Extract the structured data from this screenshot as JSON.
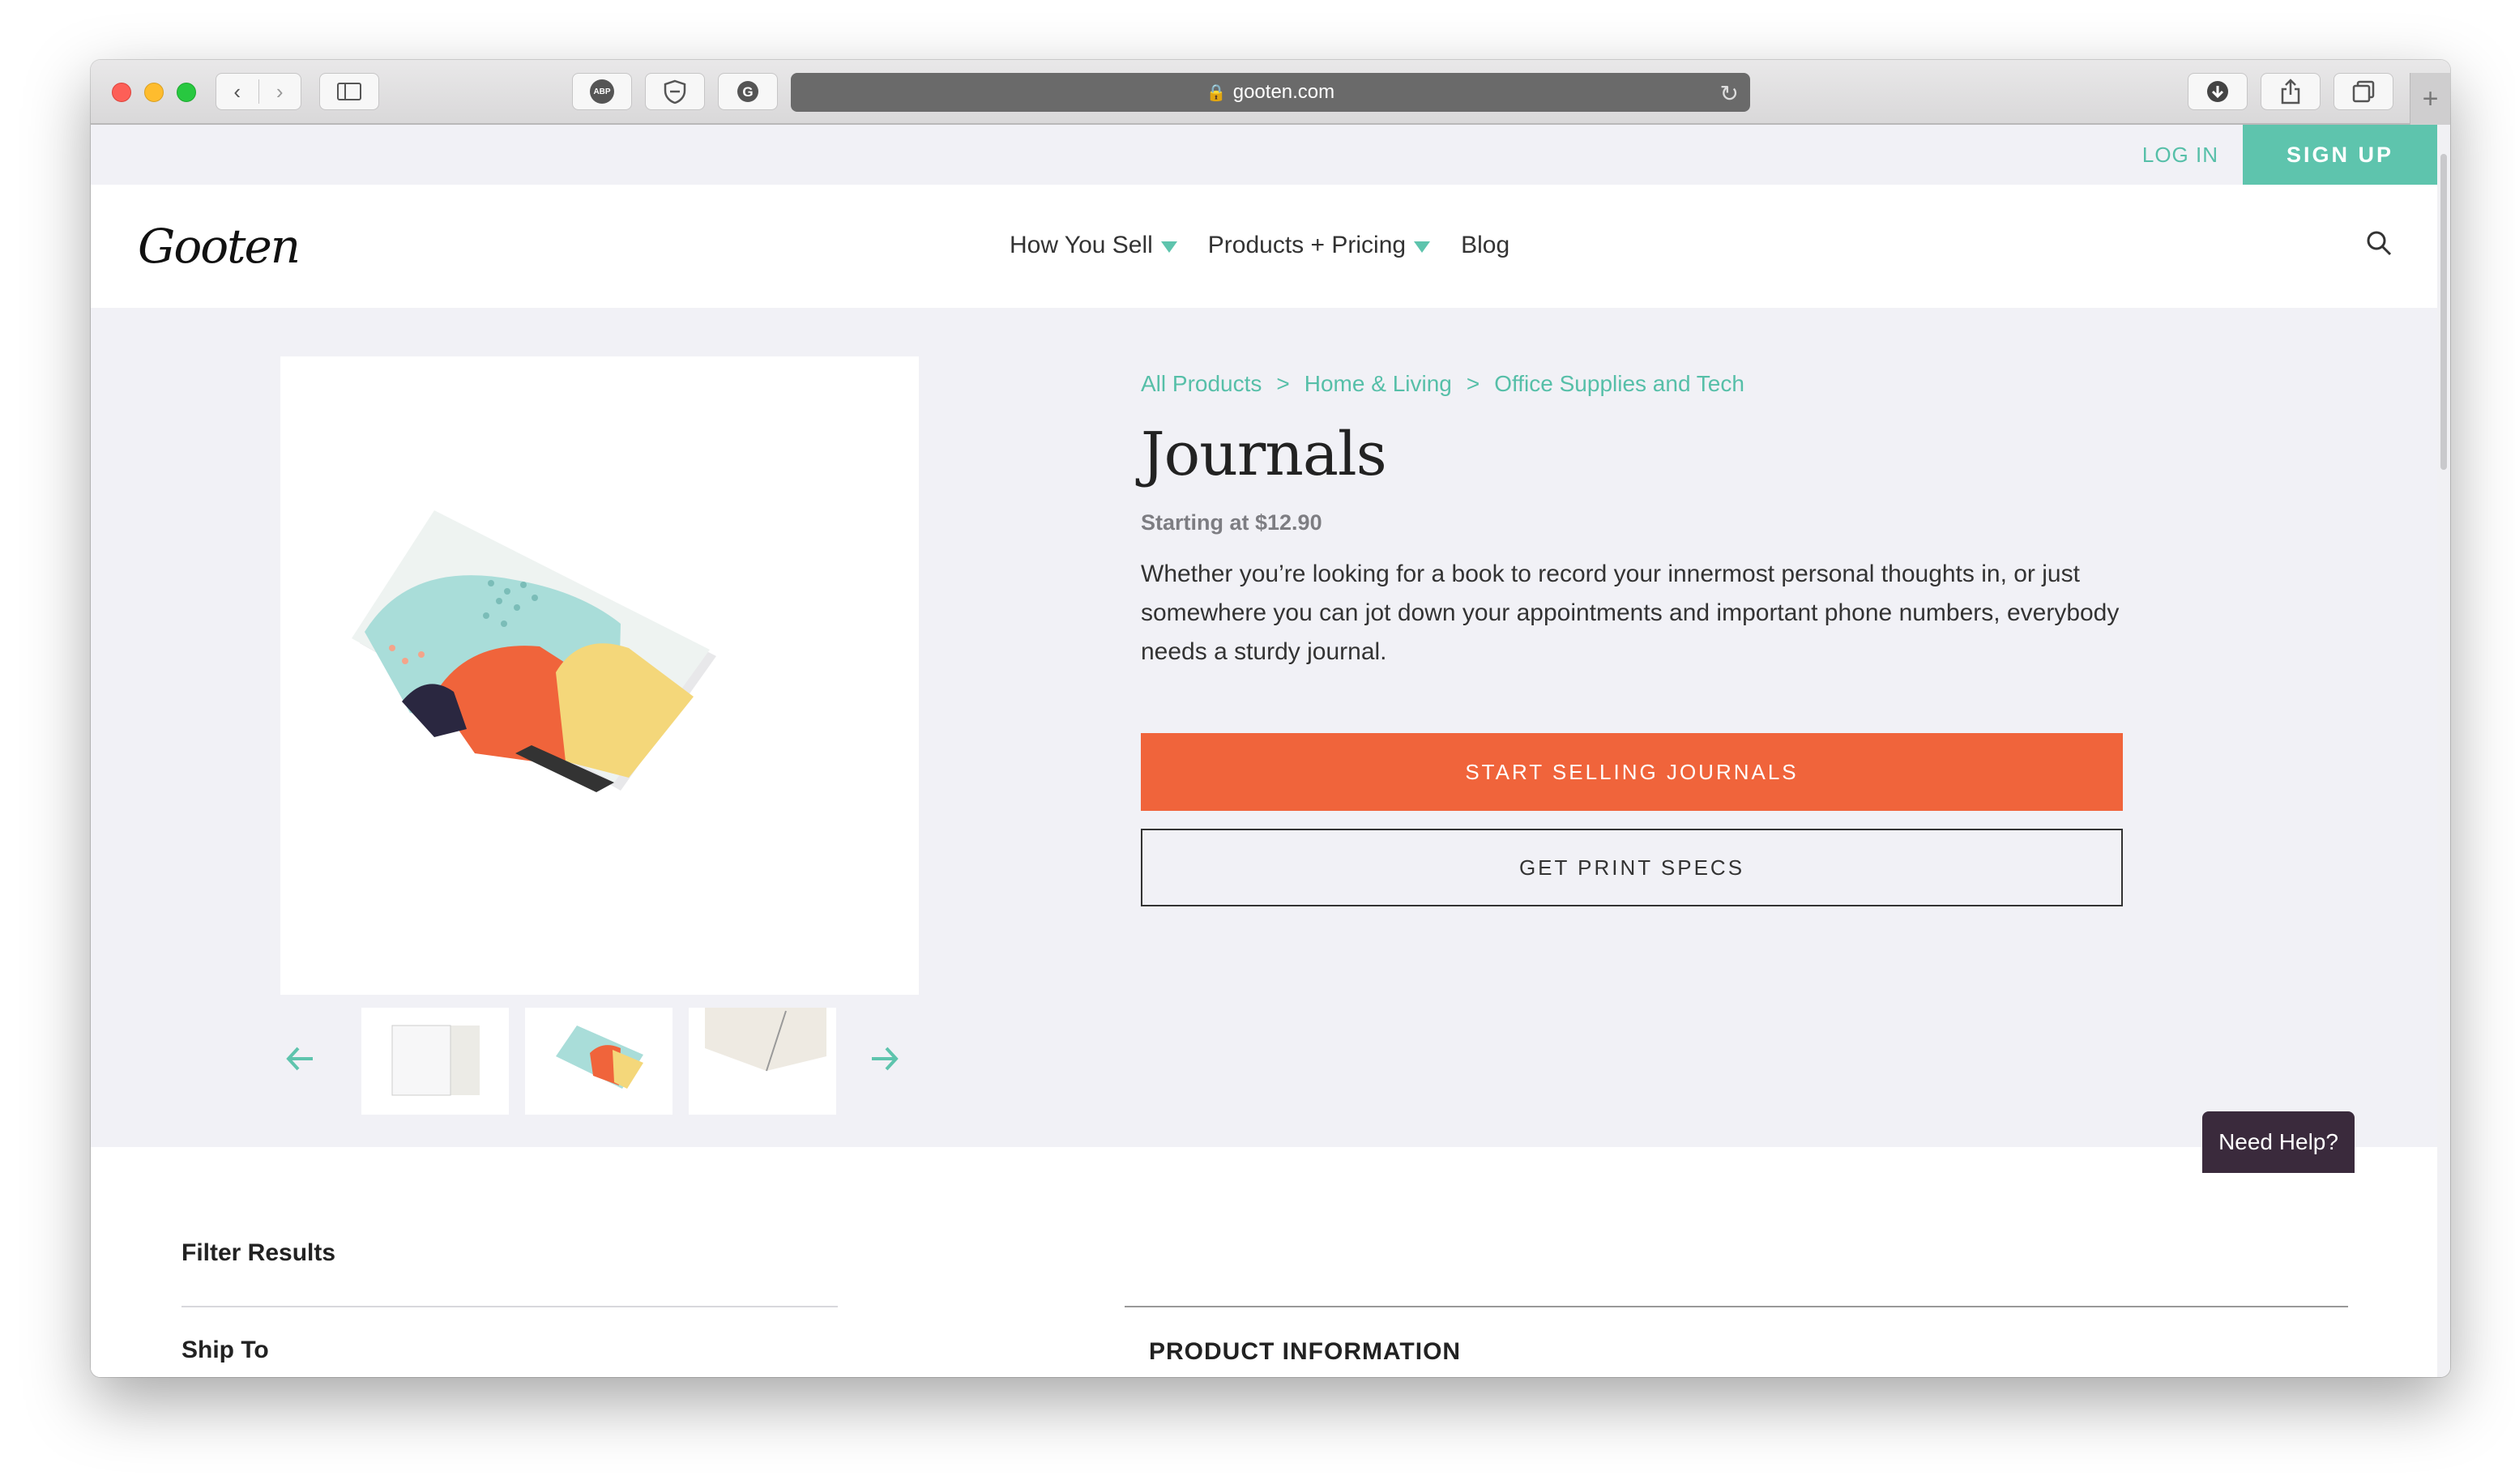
{
  "browser": {
    "url": "gooten.com",
    "adblock_badge": "ABP"
  },
  "header": {
    "login_label": "LOG IN",
    "signup_label": "SIGN UP",
    "logo_text": "Gooten",
    "nav": [
      {
        "label": "How You Sell",
        "has_dropdown": true
      },
      {
        "label": "Products + Pricing",
        "has_dropdown": true
      },
      {
        "label": "Blog",
        "has_dropdown": false
      }
    ]
  },
  "product": {
    "breadcrumbs": [
      "All Products",
      "Home & Living",
      "Office Supplies and Tech"
    ],
    "breadcrumb_separator": ">",
    "title": "Journals",
    "price": "Starting at $12.90",
    "description": "Whether you’re looking for a book to record your innermost personal thoughts in, or just somewhere you can jot down your appointments and important phone numbers, everybody needs a sturdy journal.",
    "primary_button": "START SELLING JOURNALS",
    "secondary_button": "GET PRINT SPECS"
  },
  "lower": {
    "filter_title": "Filter Results",
    "ship_to_label": "Ship To",
    "section_title": "PRODUCT INFORMATION"
  },
  "help_button": "Need Help?",
  "colors": {
    "accent": "#5ec4ad",
    "primary_button": "#f0643b",
    "hero_background": "#f1f1f6",
    "help_background": "#3a2a3c"
  }
}
